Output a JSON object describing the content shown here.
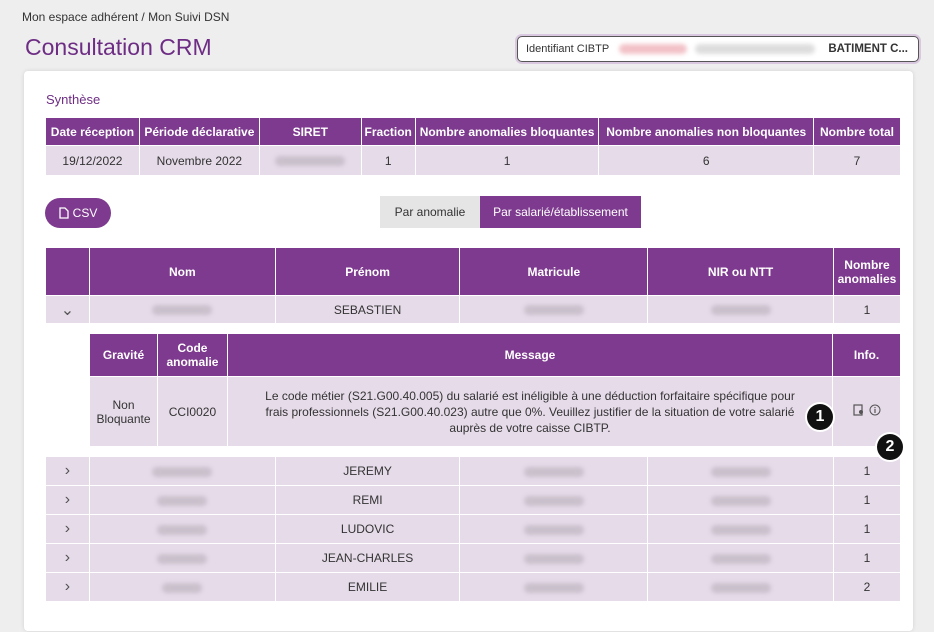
{
  "breadcrumb": "Mon espace adhérent / Mon Suivi DSN",
  "page_title": "Consultation CRM",
  "identifier": {
    "label": "Identifiant CIBTP",
    "company": "BATIMENT C..."
  },
  "synthese": {
    "label": "Synthèse",
    "headers": [
      "Date réception",
      "Période déclarative",
      "SIRET",
      "Fraction",
      "Nombre anomalies bloquantes",
      "Nombre anomalies non bloquantes",
      "Nombre total"
    ],
    "row": {
      "date": "19/12/2022",
      "periode": "Novembre 2022",
      "fraction": "1",
      "bloquantes": "1",
      "non_bloquantes": "6",
      "total": "7"
    }
  },
  "csv_button": "CSV",
  "view_toggle": {
    "option1": "Par anomalie",
    "option2": "Par salarié/établissement",
    "selected": "Par salarié/établissement"
  },
  "employees": {
    "headers": [
      "Nom",
      "Prénom",
      "Matricule",
      "NIR ou NTT",
      "Nombre anomalies"
    ],
    "rows": [
      {
        "prenom": "SEBASTIEN",
        "count": "1"
      },
      {
        "prenom": "JEREMY",
        "count": "1"
      },
      {
        "prenom": "REMI",
        "count": "1"
      },
      {
        "prenom": "LUDOVIC",
        "count": "1"
      },
      {
        "prenom": "JEAN-CHARLES",
        "count": "1"
      },
      {
        "prenom": "EMILIE",
        "count": "2"
      }
    ]
  },
  "detail": {
    "headers": [
      "Gravité",
      "Code anomalie",
      "Message",
      "Info."
    ],
    "gravite": "Non Bloquante",
    "code": "CCI0020",
    "message": "Le code métier (S21.G00.40.005) du salarié est inéligible à une déduction forfaitaire spécifique pour frais professionnels (S21.G00.40.023) autre que 0%. Veuillez justifier de la situation de votre salarié auprès de votre caisse CIBTP."
  },
  "callouts": [
    "1",
    "2"
  ],
  "colors": {
    "primary": "#7d3a8e",
    "row_bg": "#e6dbe9",
    "title": "#6e2d84"
  }
}
